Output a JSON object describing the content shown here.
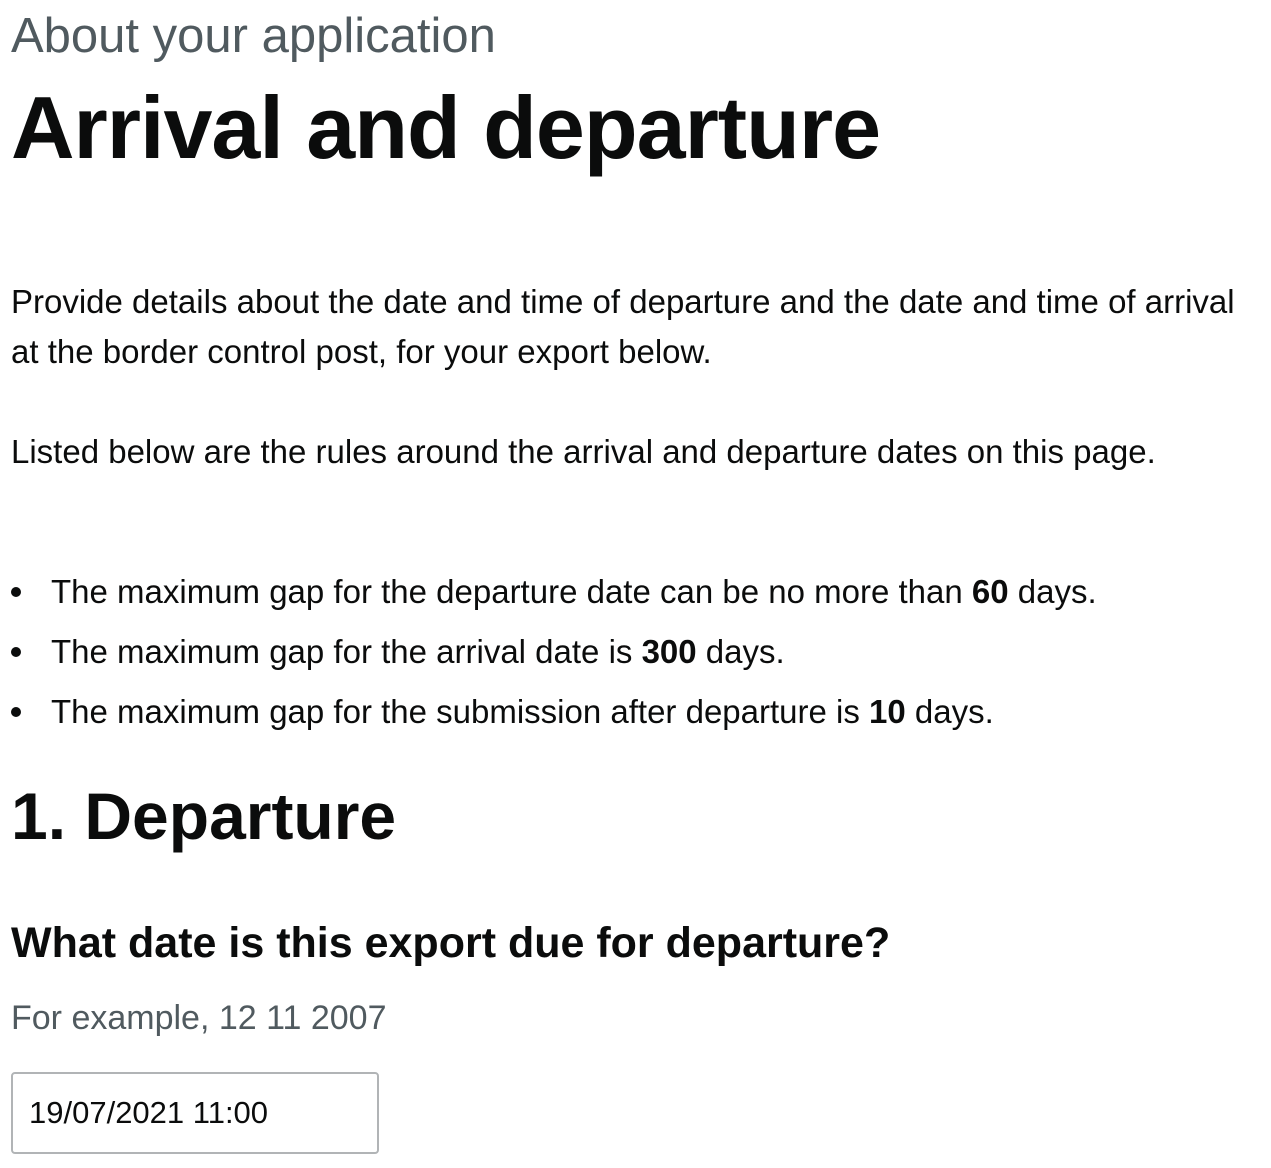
{
  "header": {
    "caption": "About your application",
    "title": "Arrival and departure"
  },
  "intro": {
    "paragraph_1": "Provide details about the date and time of departure and the date and time of arrival at the border control post, for your export below.",
    "paragraph_2": "Listed below are the rules around the arrival and departure dates on this page."
  },
  "rules": [
    {
      "before": "The maximum gap for the departure date can be no more than ",
      "value": "60",
      "after": " days."
    },
    {
      "before": "The maximum gap for the arrival date is ",
      "value": "300",
      "after": " days."
    },
    {
      "before": "The maximum gap for the submission after departure is ",
      "value": "10",
      "after": " days."
    }
  ],
  "departure": {
    "heading": "1. Departure",
    "question": "What date is this export due for departure?",
    "hint": "For example, 12 11 2007",
    "date_value": "19/07/2021 11:00"
  }
}
